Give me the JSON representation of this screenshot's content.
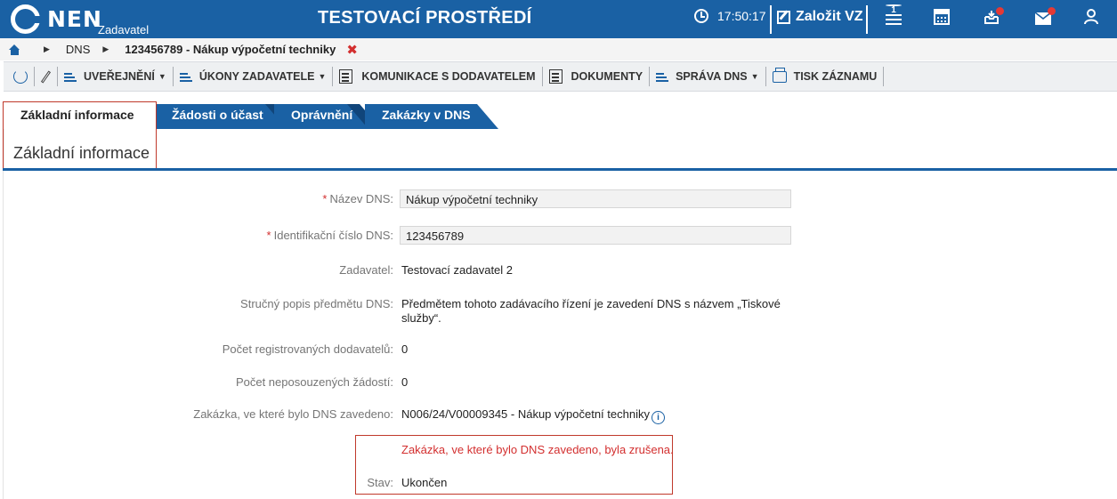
{
  "header": {
    "logo_text": "NEN",
    "logo_sub": "Zadavatel",
    "env_title": "TESTOVACÍ PROSTŘEDÍ",
    "time": "17:50:17",
    "create_label": "Založit VZ",
    "menu_badge": "1",
    "brand_color": "#1a61a4",
    "icons": [
      "clock-icon",
      "edit-icon",
      "menu-icon",
      "calculator-icon",
      "inbox-icon",
      "mail-icon",
      "user-icon"
    ]
  },
  "breadcrumb": {
    "items": [
      "DNS",
      "123456789 - Nákup výpočetní techniky"
    ]
  },
  "toolbar": {
    "items": [
      "UVEŘEJNĚNÍ",
      "ÚKONY ZADAVATELE",
      "KOMUNIKACE S DODAVATELEM",
      "DOKUMENTY",
      "SPRÁVA DNS",
      "TISK ZÁZNAMU"
    ]
  },
  "tabs": [
    "Základní informace",
    "Žádosti o účast",
    "Oprávnění",
    "Zakázky v DNS"
  ],
  "section_title": "Základní informace",
  "form": {
    "nazev_label": "Název DNS:",
    "nazev_value": "Nákup výpočetní techniky",
    "id_label": "Identifikační číslo DNS:",
    "id_value": "123456789",
    "zadavatel_label": "Zadavatel:",
    "zadavatel_value": "Testovací zadavatel 2",
    "popis_label": "Stručný popis předmětu DNS:",
    "popis_value": "Předmětem tohoto zadávacího řízení je zavedení DNS s názvem „Tiskové služby“.",
    "pocet_reg_label": "Počet registrovaných dodavatelů:",
    "pocet_reg_value": "0",
    "pocet_nepos_label": "Počet neposouzených žádostí:",
    "pocet_nepos_value": "0",
    "zakazka_label": "Zakázka, ve které bylo DNS zavedeno:",
    "zakazka_value": "N006/24/V00009345 - Nákup výpočetní techniky",
    "cancel_msg": "Zakázka, ve které bylo DNS zavedeno, byla zrušena.",
    "stav_label": "Stav:",
    "stav_value": "Ukončen"
  }
}
